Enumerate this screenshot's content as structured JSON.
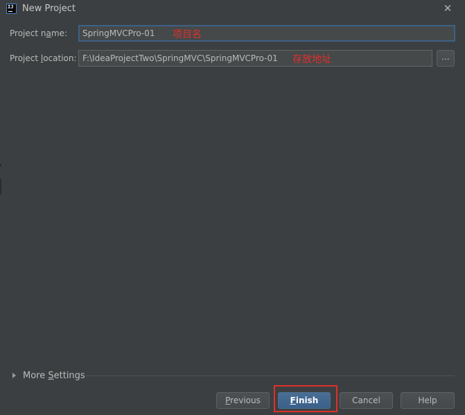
{
  "window": {
    "title": "New Project",
    "icon_text": "IJ",
    "close_icon": "close-icon"
  },
  "form": {
    "project_name": {
      "label_pre": "Project n",
      "label_mnemonic": "a",
      "label_post": "me:",
      "value": "SpringMVCPro-01",
      "annotation": "项目名"
    },
    "project_location": {
      "label_pre": "Project ",
      "label_mnemonic": "l",
      "label_post": "ocation:",
      "value": "F:\\IdeaProjectTwo\\SpringMVC\\SpringMVCPro-01",
      "annotation": "存放地址",
      "browse_label": "..."
    }
  },
  "more_settings": {
    "label_pre": "More ",
    "label_mnemonic": "S",
    "label_post": "ettings",
    "expanded": false
  },
  "buttons": {
    "previous": {
      "mnemonic": "P",
      "rest": "revious"
    },
    "finish": {
      "mnemonic": "F",
      "rest": "inish"
    },
    "cancel": "Cancel",
    "help": "Help"
  },
  "colors": {
    "background": "#3c3f41",
    "field_background": "#45494a",
    "focus_border": "#3d6185",
    "default_button": "#3b5f88",
    "annotation_red": "#e0302a"
  }
}
